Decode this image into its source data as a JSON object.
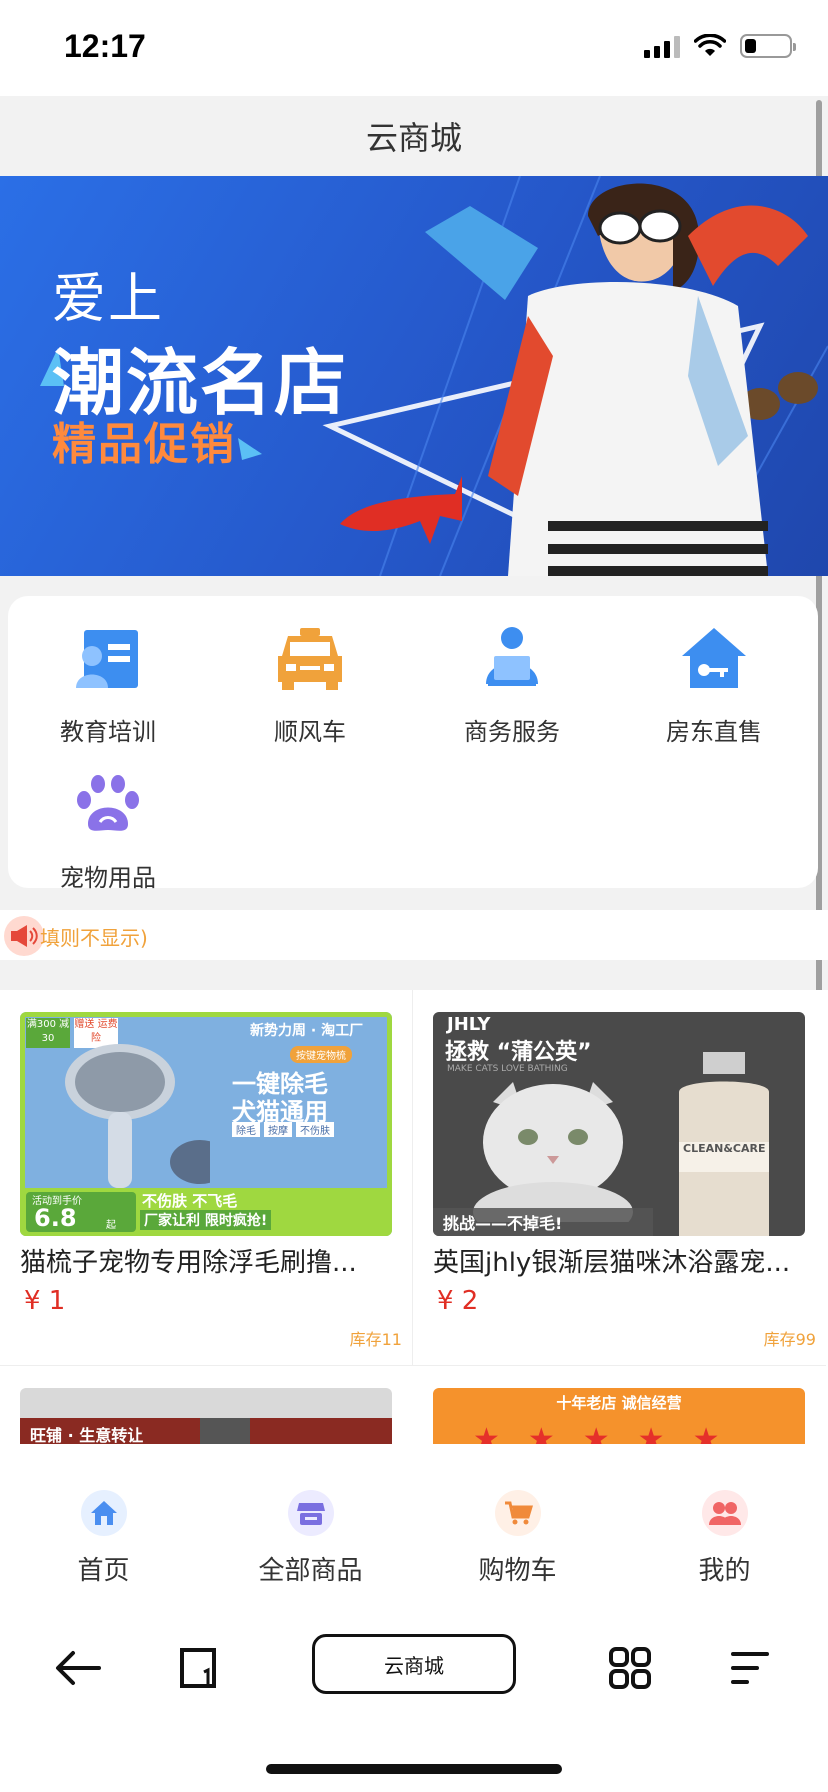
{
  "status_bar": {
    "time": "12:17",
    "battery_level": 0.25
  },
  "header": {
    "title": "云商城"
  },
  "banner": {
    "line1": "爱上",
    "line2": "潮流名店",
    "line3": "精品促销"
  },
  "categories": [
    {
      "label": "教育培训",
      "icon": "education-icon",
      "color": "#3d8ef0"
    },
    {
      "label": "顺风车",
      "icon": "taxi-icon",
      "color": "#f0a23b"
    },
    {
      "label": "商务服务",
      "icon": "business-person-icon",
      "color": "#3d8ef0"
    },
    {
      "label": "房东直售",
      "icon": "house-key-icon",
      "color": "#3d8ef0"
    },
    {
      "label": "宠物用品",
      "icon": "paw-icon",
      "color": "#8a72e8"
    }
  ],
  "notice": {
    "text": "填则不显示)"
  },
  "products": [
    {
      "title": "猫梳子宠物专用除浮毛刷撸...",
      "price": "¥ 1",
      "stock": "库存11",
      "image_text": {
        "promo1": "满300 减30",
        "promo2": "赠送 运费险",
        "brand": "新势力周 · 淘工厂",
        "tag": "按键宠物梳",
        "headline1": "一键除毛",
        "headline2": "犬猫通用",
        "chips": [
          "除毛",
          "按摩",
          "不伤肤"
        ],
        "bottom_left": "活动到手价",
        "price_big": "6.8",
        "price_unit": "起",
        "bottom_right1": "不伤肤 不飞毛",
        "bottom_right2": "厂家让利 限时疯抢!"
      }
    },
    {
      "title": "英国jhly银渐层猫咪沐浴露宠...",
      "price": "¥ 2",
      "stock": "库存99",
      "image_text": {
        "brand": "JHLY",
        "headline": "拯救 “蒲公英”",
        "sub": "MAKE CATS LOVE BATHING",
        "bottle": "CLEAN&CARE",
        "bottom": "挑战——不掉毛!"
      }
    }
  ],
  "products_partial": [
    {
      "image_text": "旺铺 · 生意转让"
    },
    {
      "image_text": "十年老店 诚信经营"
    }
  ],
  "tabs": [
    {
      "label": "首页",
      "icon": "home-icon",
      "color": "#4a8ef0",
      "bg": "#e6f0ff"
    },
    {
      "label": "全部商品",
      "icon": "store-icon",
      "color": "#7a6fe0",
      "bg": "#ecebff"
    },
    {
      "label": "购物车",
      "icon": "cart-icon",
      "color": "#f08a3b",
      "bg": "#fff0e6"
    },
    {
      "label": "我的",
      "icon": "users-icon",
      "color": "#f06565",
      "bg": "#ffe8e8"
    }
  ],
  "browser": {
    "address": "云商城"
  }
}
